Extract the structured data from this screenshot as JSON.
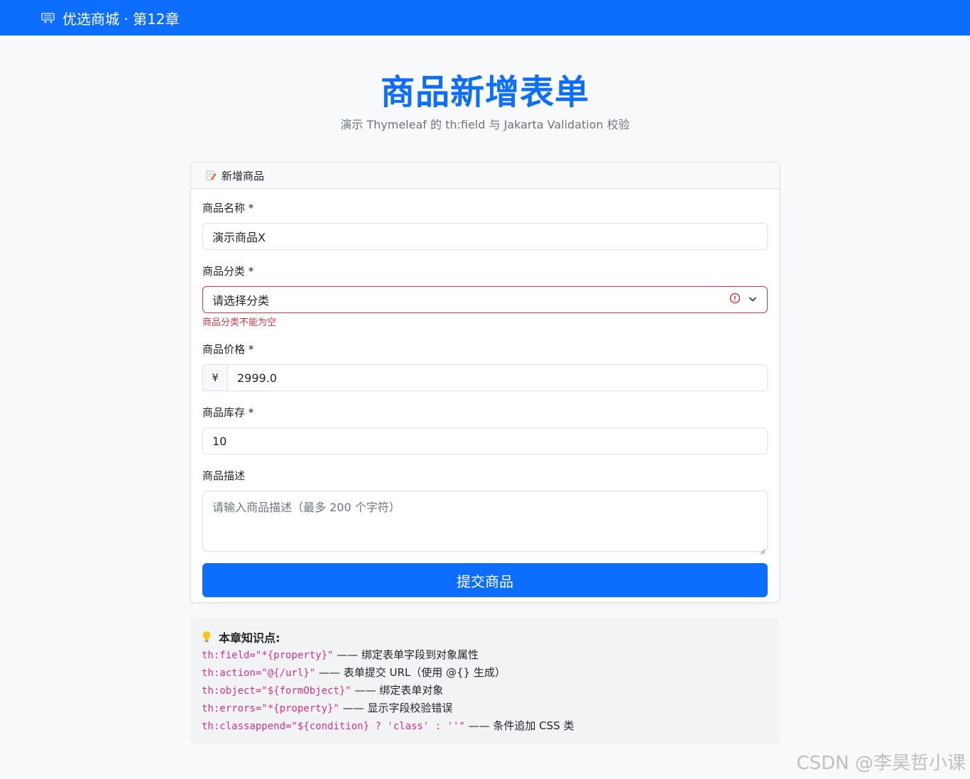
{
  "navbar": {
    "brand": "优选商城 · 第12章",
    "brand_icon": "cart-icon"
  },
  "hero": {
    "title": "商品新增表单",
    "subtitle": "演示 Thymeleaf 的 th:field 与 Jakarta Validation 校验"
  },
  "card": {
    "header_icon": "memo-icon",
    "header": "新增商品",
    "name": {
      "label": "商品名称 *",
      "value": "演示商品X"
    },
    "category": {
      "label": "商品分类 *",
      "value": "请选择分类",
      "error": "商品分类不能为空",
      "error_color": "#dc3545"
    },
    "price": {
      "label": "商品价格 *",
      "prefix": "¥",
      "value": "2999.0"
    },
    "stock": {
      "label": "商品库存 *",
      "value": "10"
    },
    "description": {
      "label": "商品描述",
      "placeholder": "请输入商品描述（最多 200 个字符）"
    },
    "submit": "提交商品"
  },
  "tips": {
    "icon": "lightbulb-icon",
    "title": "本章知识点:",
    "items": [
      {
        "code": "th:field=\"*{property}\"",
        "text": " —— 绑定表单字段到对象属性"
      },
      {
        "code": "th:action=\"@{/url}\"",
        "text": " —— 表单提交 URL（使用 @{} 生成）"
      },
      {
        "code": "th:object=\"${formObject}\"",
        "text": " —— 绑定表单对象"
      },
      {
        "code": "th:errors=\"*{property}\"",
        "text": " —— 显示字段校验错误"
      },
      {
        "code": "th:classappend=\"${condition} ? 'class' : ''\"",
        "text": " —— 条件追加 CSS 类"
      }
    ]
  },
  "watermark": "CSDN @李昊哲小课",
  "colors": {
    "primary": "#0d6efd",
    "danger": "#dc3545",
    "code": "#d63384"
  }
}
